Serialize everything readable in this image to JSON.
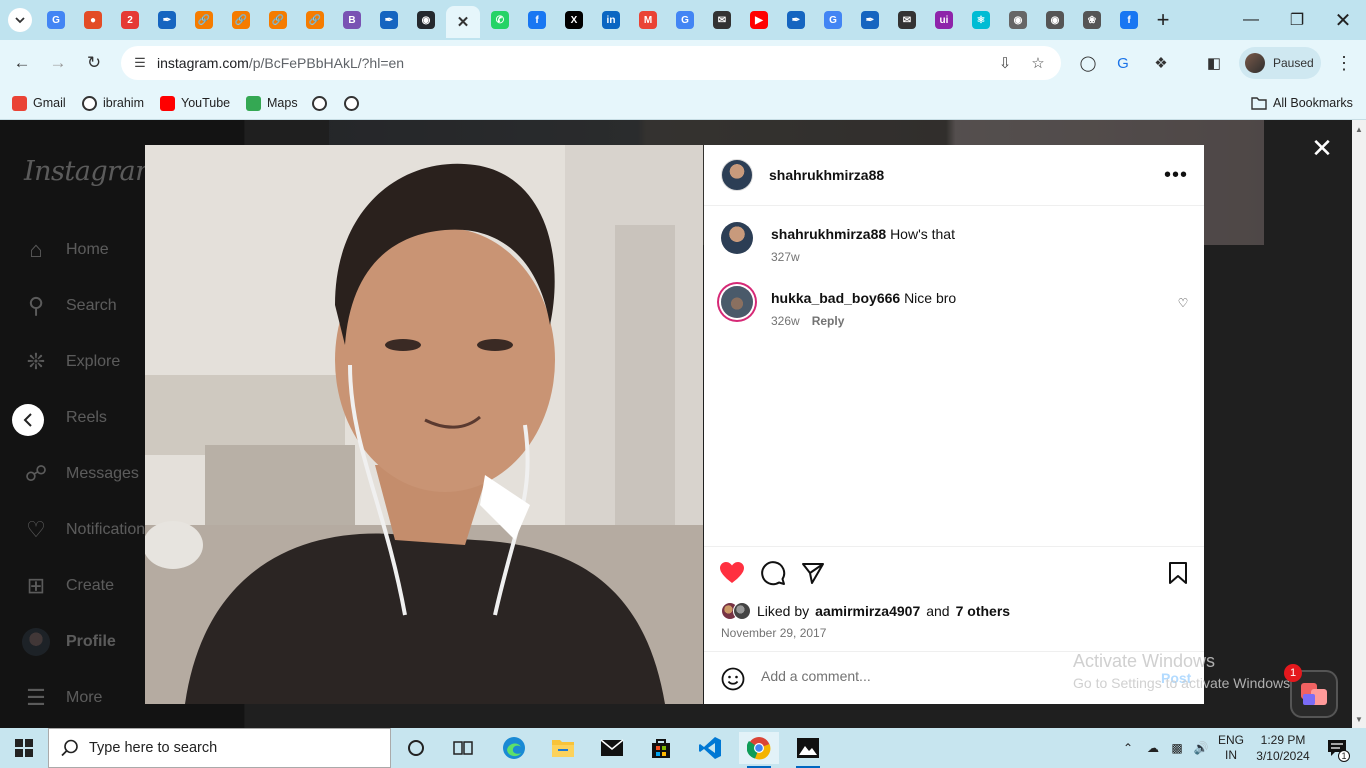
{
  "browser": {
    "tabs": [
      {
        "icon": "google-icon",
        "color": "#4285f4"
      },
      {
        "icon": "colorful-icon",
        "color": "#e34c26"
      },
      {
        "icon": "2-icon",
        "color": "#e53935"
      },
      {
        "icon": "pen-icon",
        "color": "#1565c0"
      },
      {
        "icon": "link-icon",
        "color": "#f57c00"
      },
      {
        "icon": "link-icon",
        "color": "#f57c00"
      },
      {
        "icon": "link-icon",
        "color": "#f57c00"
      },
      {
        "icon": "link-icon",
        "color": "#f57c00"
      },
      {
        "icon": "bootstrap-icon",
        "color": "#7952b3"
      },
      {
        "icon": "pen-icon",
        "color": "#1565c0"
      },
      {
        "icon": "github-icon",
        "color": "#24292e"
      },
      {
        "icon": "close-icon",
        "color": "#333333",
        "active": true
      },
      {
        "icon": "whatsapp-icon",
        "color": "#25d366"
      },
      {
        "icon": "facebook-icon",
        "color": "#1877f2"
      },
      {
        "icon": "x-icon",
        "color": "#000000"
      },
      {
        "icon": "linkedin-icon",
        "color": "#0a66c2"
      },
      {
        "icon": "gmail-icon",
        "color": "#ea4335"
      },
      {
        "icon": "google-icon",
        "color": "#4285f4"
      },
      {
        "icon": "mail-icon",
        "color": "#333333"
      },
      {
        "icon": "youtube-icon",
        "color": "#ff0000"
      },
      {
        "icon": "pen-icon",
        "color": "#1565c0"
      },
      {
        "icon": "google-icon",
        "color": "#4285f4"
      },
      {
        "icon": "pen-icon",
        "color": "#1565c0"
      },
      {
        "icon": "mail-icon",
        "color": "#333333"
      },
      {
        "icon": "ui-icon",
        "color": "#8e24aa"
      },
      {
        "icon": "react-icon",
        "color": "#00bcd4"
      },
      {
        "icon": "globe-icon",
        "color": "#666666"
      },
      {
        "icon": "chrome-icon",
        "color": "#555555"
      },
      {
        "icon": "openai-icon",
        "color": "#555555"
      },
      {
        "icon": "facebook-icon",
        "color": "#1877f2"
      }
    ],
    "url_host": "instagram.com",
    "url_path": "/p/BcFePBbHAkL/?hl=en",
    "profile_status": "Paused",
    "bookmarks": [
      {
        "label": "Gmail",
        "icon": "gmail-icon",
        "color": "#ea4335"
      },
      {
        "label": "ibrahim",
        "icon": "globe-icon",
        "color": "#333333"
      },
      {
        "label": "YouTube",
        "icon": "youtube-icon",
        "color": "#ff0000"
      },
      {
        "label": "Maps",
        "icon": "maps-icon",
        "color": "#34a853"
      },
      {
        "label": "",
        "icon": "globe-icon",
        "color": "#333333"
      },
      {
        "label": "",
        "icon": "globe-icon",
        "color": "#333333"
      }
    ],
    "all_bookmarks": "All Bookmarks"
  },
  "instagram": {
    "logo": "Instagram",
    "nav": [
      {
        "label": "Home",
        "icon": "home-icon"
      },
      {
        "label": "Search",
        "icon": "search-icon"
      },
      {
        "label": "Explore",
        "icon": "explore-icon"
      },
      {
        "label": "Reels",
        "icon": "reels-icon"
      },
      {
        "label": "Messages",
        "icon": "messenger-icon"
      },
      {
        "label": "Notifications",
        "icon": "heart-icon"
      },
      {
        "label": "Create",
        "icon": "plus-icon"
      },
      {
        "label": "Profile",
        "icon": "avatar"
      },
      {
        "label": "More",
        "icon": "menu-icon"
      }
    ]
  },
  "post": {
    "author": "shahrukhmirza88",
    "comments": [
      {
        "user": "shahrukhmirza88",
        "text": "How's that",
        "age": "327w",
        "reply": ""
      },
      {
        "user": "hukka_bad_boy666",
        "text": "Nice bro",
        "age": "326w",
        "reply": "Reply"
      }
    ],
    "liked_prefix": "Liked by",
    "liked_user": "aamirmirza4907",
    "liked_and": "and",
    "liked_others": "7 others",
    "date": "November 29, 2017",
    "comment_placeholder": "Add a comment...",
    "post_label": "Post",
    "liked": true
  },
  "overlay": {
    "activate_title": "Activate Windows",
    "activate_sub": "Go to Settings to activate Windows.",
    "notification_count": "1"
  },
  "taskbar": {
    "search_placeholder": "Type here to search",
    "lang_top": "ENG",
    "lang_bottom": "IN",
    "time": "1:29 PM",
    "date": "3/10/2024",
    "notification_count": "1"
  }
}
